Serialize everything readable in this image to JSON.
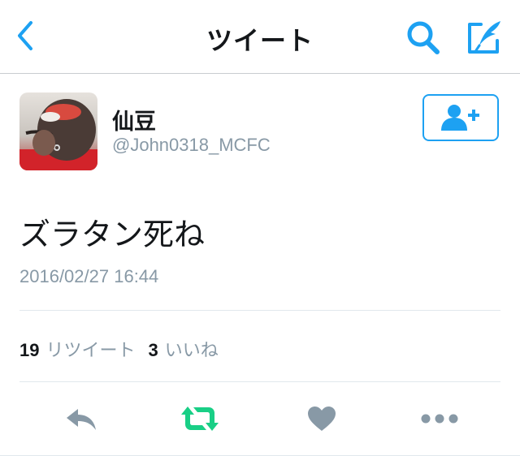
{
  "nav": {
    "title": "ツイート",
    "back_icon": "chevron-left-icon",
    "search_icon": "search-icon",
    "compose_icon": "compose-tweet-icon",
    "accent_color": "#1da1f2"
  },
  "tweet": {
    "author": {
      "display_name": "仙豆",
      "handle": "@John0318_MCFC"
    },
    "follow_icon": "add-user-icon",
    "text": "ズラタン死ね",
    "timestamp": "2016/02/27 16:44"
  },
  "stats": {
    "retweets_count": "19",
    "retweets_label": "リツイート",
    "likes_count": "3",
    "likes_label": "いいね"
  },
  "actions": {
    "reply_icon": "reply-icon",
    "retweet_icon": "retweet-icon",
    "retweet_color": "#19cf86",
    "like_icon": "heart-icon",
    "more_icon": "more-icon"
  }
}
